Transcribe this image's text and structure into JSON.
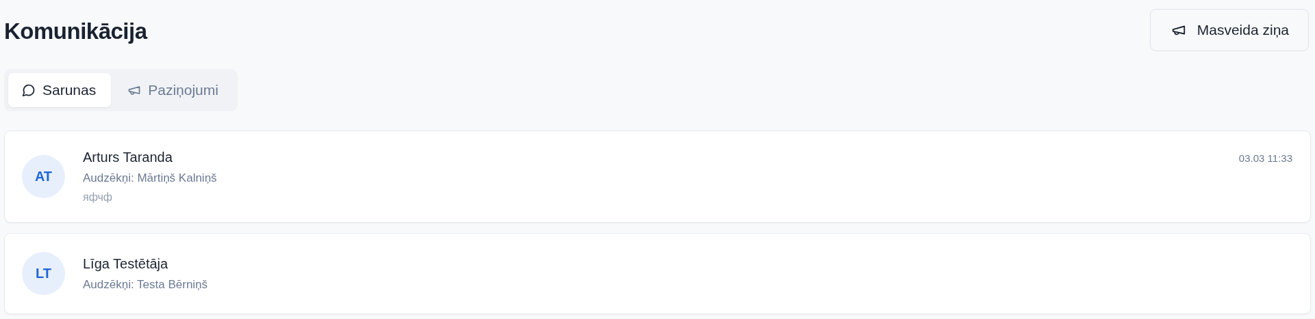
{
  "page": {
    "title": "Komunikācija",
    "action_button": "Masveida ziņa"
  },
  "tabs": [
    {
      "label": "Sarunas",
      "selected": true,
      "kind": "chat"
    },
    {
      "label": "Paziņojumi",
      "selected": false,
      "kind": "megaphone"
    }
  ],
  "conversations": [
    {
      "initials": "AT",
      "name": "Arturs Taranda",
      "subtitle": "Audzēkņi: Mārtiņš Kalniņš",
      "preview": "яфчф",
      "time": "03.03 11:33"
    },
    {
      "initials": "LT",
      "name": "Līga Testētāja",
      "subtitle": "Audzēkņi: Testa Bērniņš"
    }
  ]
}
